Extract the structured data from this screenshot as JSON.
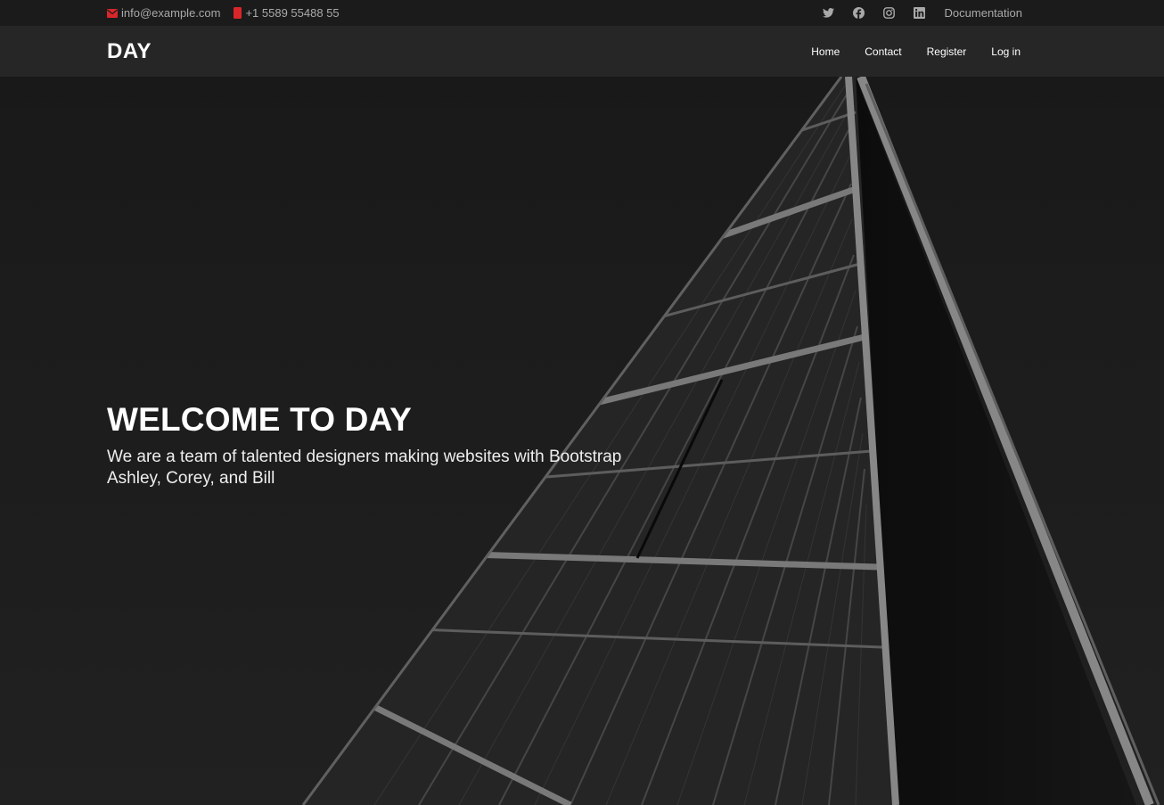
{
  "topbar": {
    "email": "info@example.com",
    "phone": "+1 5589 55488 55",
    "social": [
      "twitter-icon",
      "facebook-icon",
      "instagram-icon",
      "linkedin-icon"
    ],
    "documentation": "Documentation"
  },
  "header": {
    "logo": "DAY",
    "nav": [
      "Home",
      "Contact",
      "Register",
      "Log in"
    ]
  },
  "hero": {
    "title": "WELCOME TO DAY",
    "subtitle_line1": "We are a team of talented designers making websites with Bootstrap",
    "subtitle_line2": "Ashley, Corey, and Bill"
  },
  "colors": {
    "accent": "#e22b2b",
    "topbar_bg": "#1b1b1b",
    "header_bg": "#262626",
    "hero_bg": "#222222"
  }
}
